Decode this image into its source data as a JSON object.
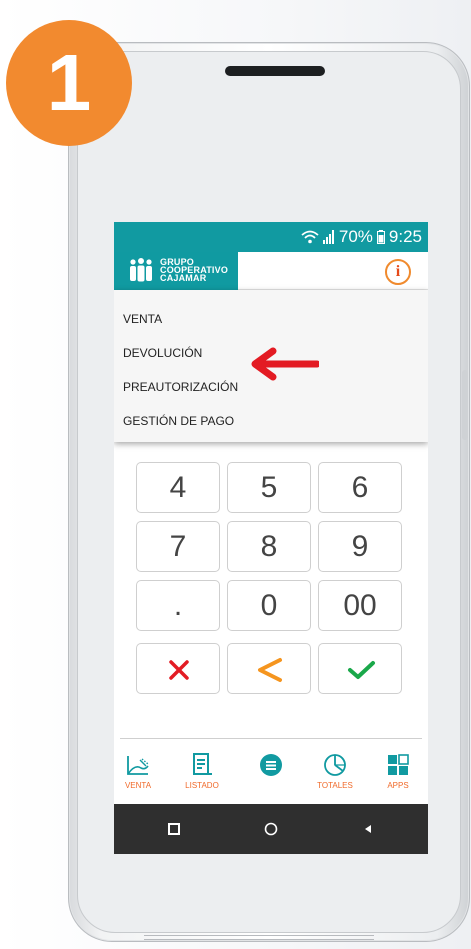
{
  "step": {
    "number": "1"
  },
  "status_bar": {
    "battery": "70%",
    "time": "9:25"
  },
  "header": {
    "logo_lines": [
      "GRUPO",
      "COOPERATIVO",
      "CAJAMAR"
    ],
    "info_icon": "info-icon"
  },
  "menu": {
    "items": [
      "VENTA",
      "DEVOLUCIÓN",
      "PREAUTORIZACIÓN",
      "GESTIÓN DE PAGO"
    ],
    "highlighted": "GESTIÓN DE PAGO"
  },
  "keypad": {
    "rows": [
      [
        "4",
        "5",
        "6"
      ],
      [
        "7",
        "8",
        "9"
      ],
      [
        ".",
        "0",
        "00"
      ]
    ],
    "actions": {
      "cancel": "✕",
      "back": "<",
      "ok": "✓"
    }
  },
  "tabs": [
    {
      "label": "VENTA",
      "icon": "receipt-printer-icon"
    },
    {
      "label": "LISTADO",
      "icon": "list-document-icon"
    },
    {
      "label": "",
      "icon": "menu-icon"
    },
    {
      "label": "TOTALES",
      "icon": "pie-chart-icon"
    },
    {
      "label": "APPS",
      "icon": "apps-grid-icon"
    }
  ],
  "colors": {
    "teal": "#119aa1",
    "orange": "#f08a2d",
    "red": "#e31b23",
    "green": "#1aa84a",
    "badge": "#f28a2f"
  }
}
